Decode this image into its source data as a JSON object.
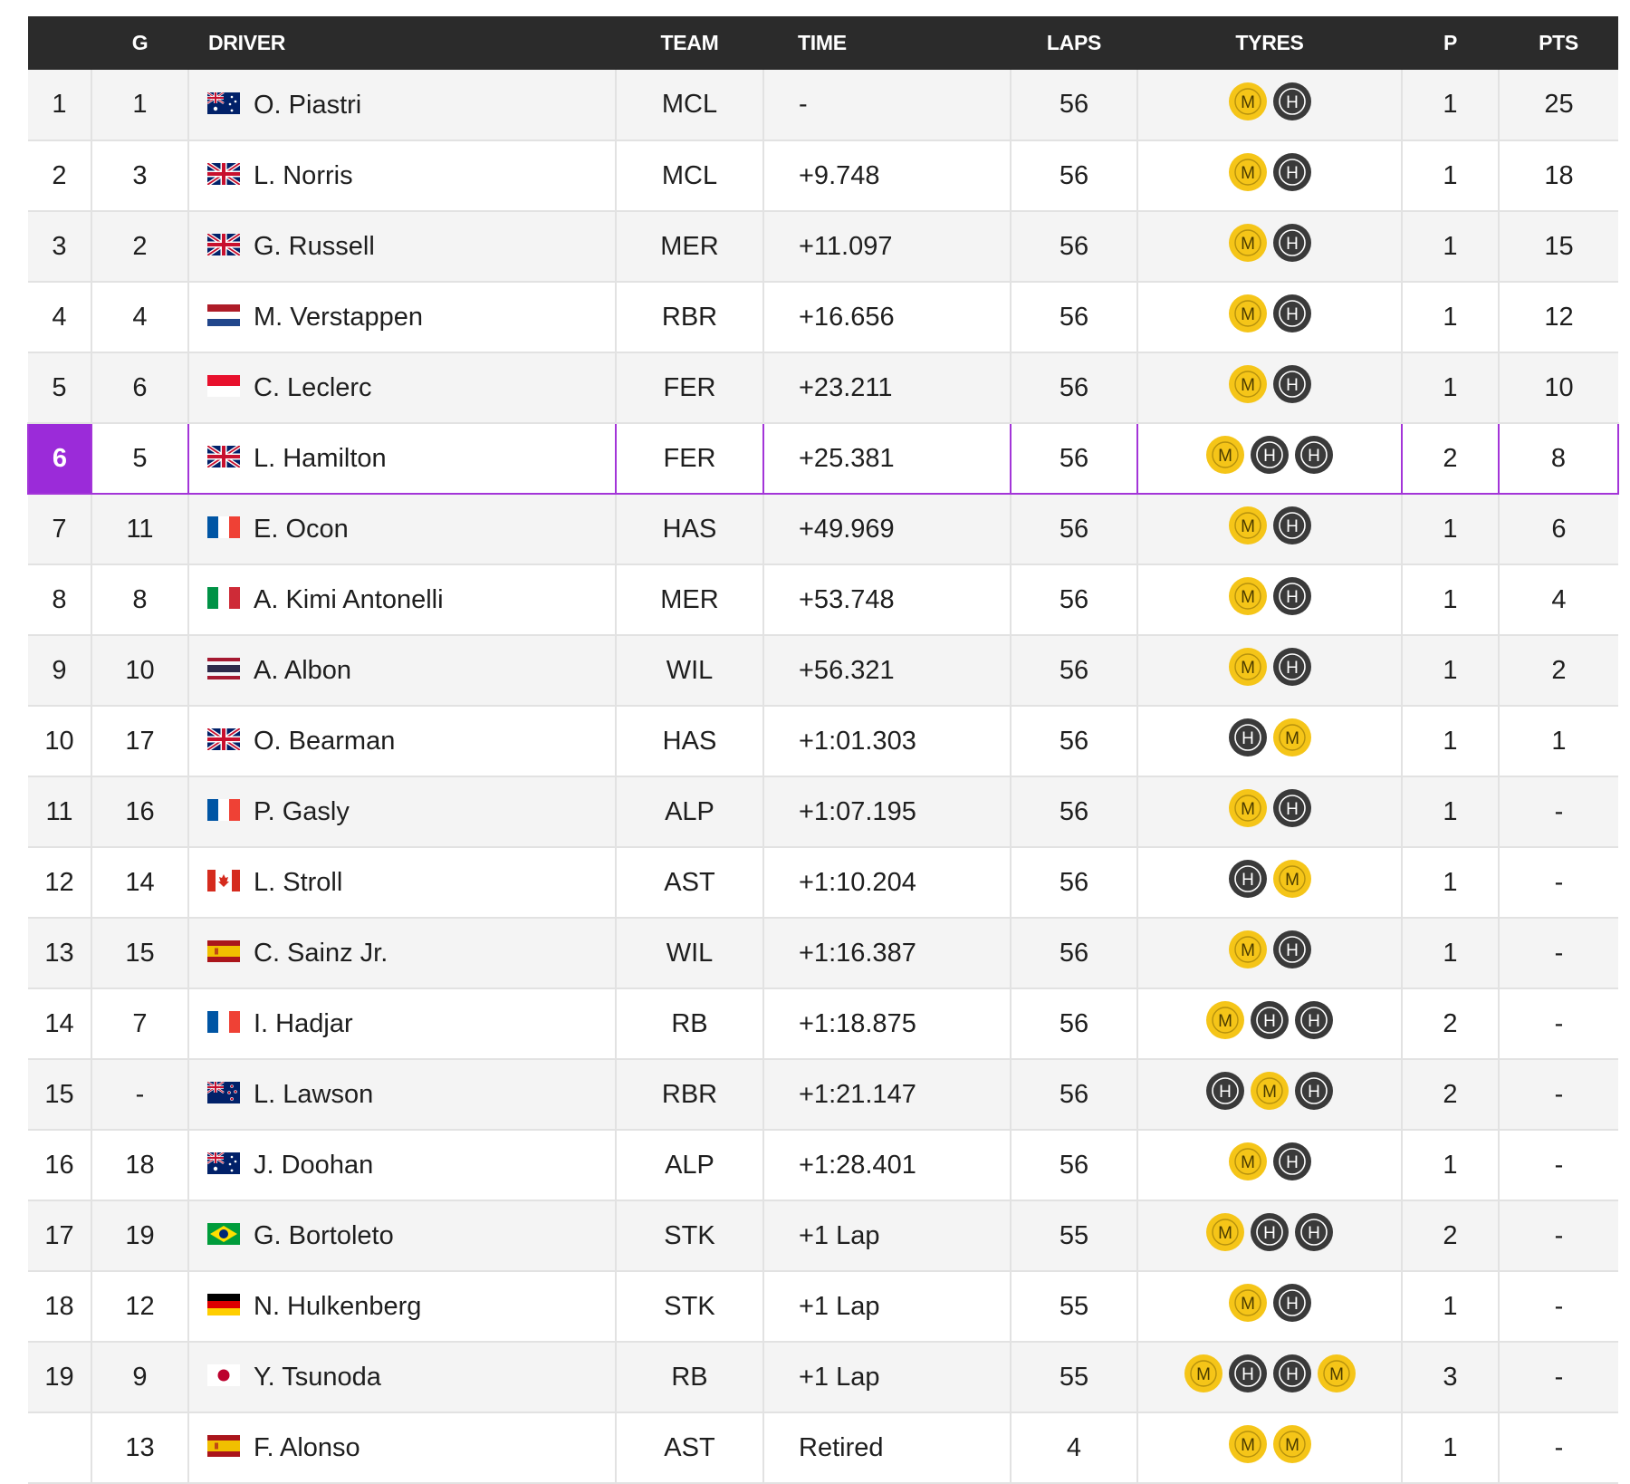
{
  "headers": {
    "pos": "",
    "grid": "G",
    "driver": "DRIVER",
    "team": "TEAM",
    "time": "TIME",
    "laps": "LAPS",
    "tyres": "TYRES",
    "pits": "P",
    "pts": "PTS"
  },
  "colors": {
    "header_bg": "#2b2b2b",
    "highlight": "#9b2bd9",
    "medium_tyre": "#f5c518",
    "hard_tyre": "#3a3a3a"
  },
  "tyre_labels": {
    "M": "M",
    "H": "H"
  },
  "highlight_row": 5,
  "rows": [
    {
      "pos": "1",
      "grid": "1",
      "flag": "AUS",
      "driver": "O. Piastri",
      "team": "MCL",
      "time": "-",
      "laps": "56",
      "tyres": [
        "M",
        "H"
      ],
      "pits": "1",
      "pts": "25"
    },
    {
      "pos": "2",
      "grid": "3",
      "flag": "GBR",
      "driver": "L. Norris",
      "team": "MCL",
      "time": "+9.748",
      "laps": "56",
      "tyres": [
        "M",
        "H"
      ],
      "pits": "1",
      "pts": "18"
    },
    {
      "pos": "3",
      "grid": "2",
      "flag": "GBR",
      "driver": "G. Russell",
      "team": "MER",
      "time": "+11.097",
      "laps": "56",
      "tyres": [
        "M",
        "H"
      ],
      "pits": "1",
      "pts": "15"
    },
    {
      "pos": "4",
      "grid": "4",
      "flag": "NED",
      "driver": "M. Verstappen",
      "team": "RBR",
      "time": "+16.656",
      "laps": "56",
      "tyres": [
        "M",
        "H"
      ],
      "pits": "1",
      "pts": "12"
    },
    {
      "pos": "5",
      "grid": "6",
      "flag": "MON",
      "driver": "C. Leclerc",
      "team": "FER",
      "time": "+23.211",
      "laps": "56",
      "tyres": [
        "M",
        "H"
      ],
      "pits": "1",
      "pts": "10"
    },
    {
      "pos": "6",
      "grid": "5",
      "flag": "GBR",
      "driver": "L. Hamilton",
      "team": "FER",
      "time": "+25.381",
      "laps": "56",
      "tyres": [
        "M",
        "H",
        "H"
      ],
      "pits": "2",
      "pts": "8"
    },
    {
      "pos": "7",
      "grid": "11",
      "flag": "FRA",
      "driver": "E. Ocon",
      "team": "HAS",
      "time": "+49.969",
      "laps": "56",
      "tyres": [
        "M",
        "H"
      ],
      "pits": "1",
      "pts": "6"
    },
    {
      "pos": "8",
      "grid": "8",
      "flag": "ITA",
      "driver": "A. Kimi Antonelli",
      "team": "MER",
      "time": "+53.748",
      "laps": "56",
      "tyres": [
        "M",
        "H"
      ],
      "pits": "1",
      "pts": "4"
    },
    {
      "pos": "9",
      "grid": "10",
      "flag": "THA",
      "driver": "A. Albon",
      "team": "WIL",
      "time": "+56.321",
      "laps": "56",
      "tyres": [
        "M",
        "H"
      ],
      "pits": "1",
      "pts": "2"
    },
    {
      "pos": "10",
      "grid": "17",
      "flag": "GBR",
      "driver": "O. Bearman",
      "team": "HAS",
      "time": "+1:01.303",
      "laps": "56",
      "tyres": [
        "H",
        "M"
      ],
      "pits": "1",
      "pts": "1"
    },
    {
      "pos": "11",
      "grid": "16",
      "flag": "FRA",
      "driver": "P. Gasly",
      "team": "ALP",
      "time": "+1:07.195",
      "laps": "56",
      "tyres": [
        "M",
        "H"
      ],
      "pits": "1",
      "pts": "-"
    },
    {
      "pos": "12",
      "grid": "14",
      "flag": "CAN",
      "driver": "L. Stroll",
      "team": "AST",
      "time": "+1:10.204",
      "laps": "56",
      "tyres": [
        "H",
        "M"
      ],
      "pits": "1",
      "pts": "-"
    },
    {
      "pos": "13",
      "grid": "15",
      "flag": "ESP",
      "driver": "C. Sainz Jr.",
      "team": "WIL",
      "time": "+1:16.387",
      "laps": "56",
      "tyres": [
        "M",
        "H"
      ],
      "pits": "1",
      "pts": "-"
    },
    {
      "pos": "14",
      "grid": "7",
      "flag": "FRA",
      "driver": "I. Hadjar",
      "team": "RB",
      "time": "+1:18.875",
      "laps": "56",
      "tyres": [
        "M",
        "H",
        "H"
      ],
      "pits": "2",
      "pts": "-"
    },
    {
      "pos": "15",
      "grid": "-",
      "flag": "NZL",
      "driver": "L. Lawson",
      "team": "RBR",
      "time": "+1:21.147",
      "laps": "56",
      "tyres": [
        "H",
        "M",
        "H"
      ],
      "pits": "2",
      "pts": "-"
    },
    {
      "pos": "16",
      "grid": "18",
      "flag": "AUS",
      "driver": "J. Doohan",
      "team": "ALP",
      "time": "+1:28.401",
      "laps": "56",
      "tyres": [
        "M",
        "H"
      ],
      "pits": "1",
      "pts": "-"
    },
    {
      "pos": "17",
      "grid": "19",
      "flag": "BRA",
      "driver": "G. Bortoleto",
      "team": "STK",
      "time": "+1 Lap",
      "laps": "55",
      "tyres": [
        "M",
        "H",
        "H"
      ],
      "pits": "2",
      "pts": "-"
    },
    {
      "pos": "18",
      "grid": "12",
      "flag": "GER",
      "driver": "N. Hulkenberg",
      "team": "STK",
      "time": "+1 Lap",
      "laps": "55",
      "tyres": [
        "M",
        "H"
      ],
      "pits": "1",
      "pts": "-"
    },
    {
      "pos": "19",
      "grid": "9",
      "flag": "JPN",
      "driver": "Y. Tsunoda",
      "team": "RB",
      "time": "+1 Lap",
      "laps": "55",
      "tyres": [
        "M",
        "H",
        "H",
        "M"
      ],
      "pits": "3",
      "pts": "-"
    },
    {
      "pos": "",
      "grid": "13",
      "flag": "ESP",
      "driver": "F. Alonso",
      "team": "AST",
      "time": "Retired",
      "laps": "4",
      "tyres": [
        "M",
        "M"
      ],
      "pits": "1",
      "pts": "-"
    }
  ]
}
